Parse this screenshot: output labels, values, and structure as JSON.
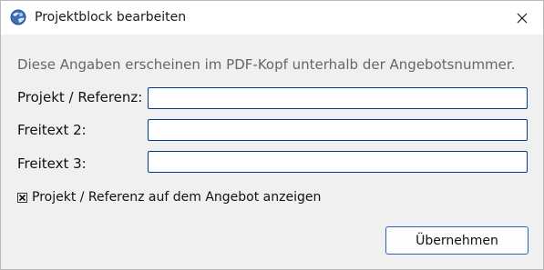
{
  "window": {
    "title": "Projektblock bearbeiten",
    "app_icon": "globe-app-icon",
    "close_icon": "close-icon"
  },
  "description": "Diese Angaben erscheinen im PDF-Kopf unterhalb der Angebotsnummer.",
  "fields": [
    {
      "label": "Projekt / Referenz:",
      "value": ""
    },
    {
      "label": "Freitext 2:",
      "value": ""
    },
    {
      "label": "Freitext 3:",
      "value": ""
    }
  ],
  "checkbox": {
    "label": "Projekt / Referenz auf dem Angebot anzeigen",
    "checked": true
  },
  "buttons": {
    "apply_label": "Übernehmen"
  },
  "colors": {
    "accent": "#003c8c",
    "button_border": "#2a64b8",
    "background": "#f0f0f0"
  }
}
